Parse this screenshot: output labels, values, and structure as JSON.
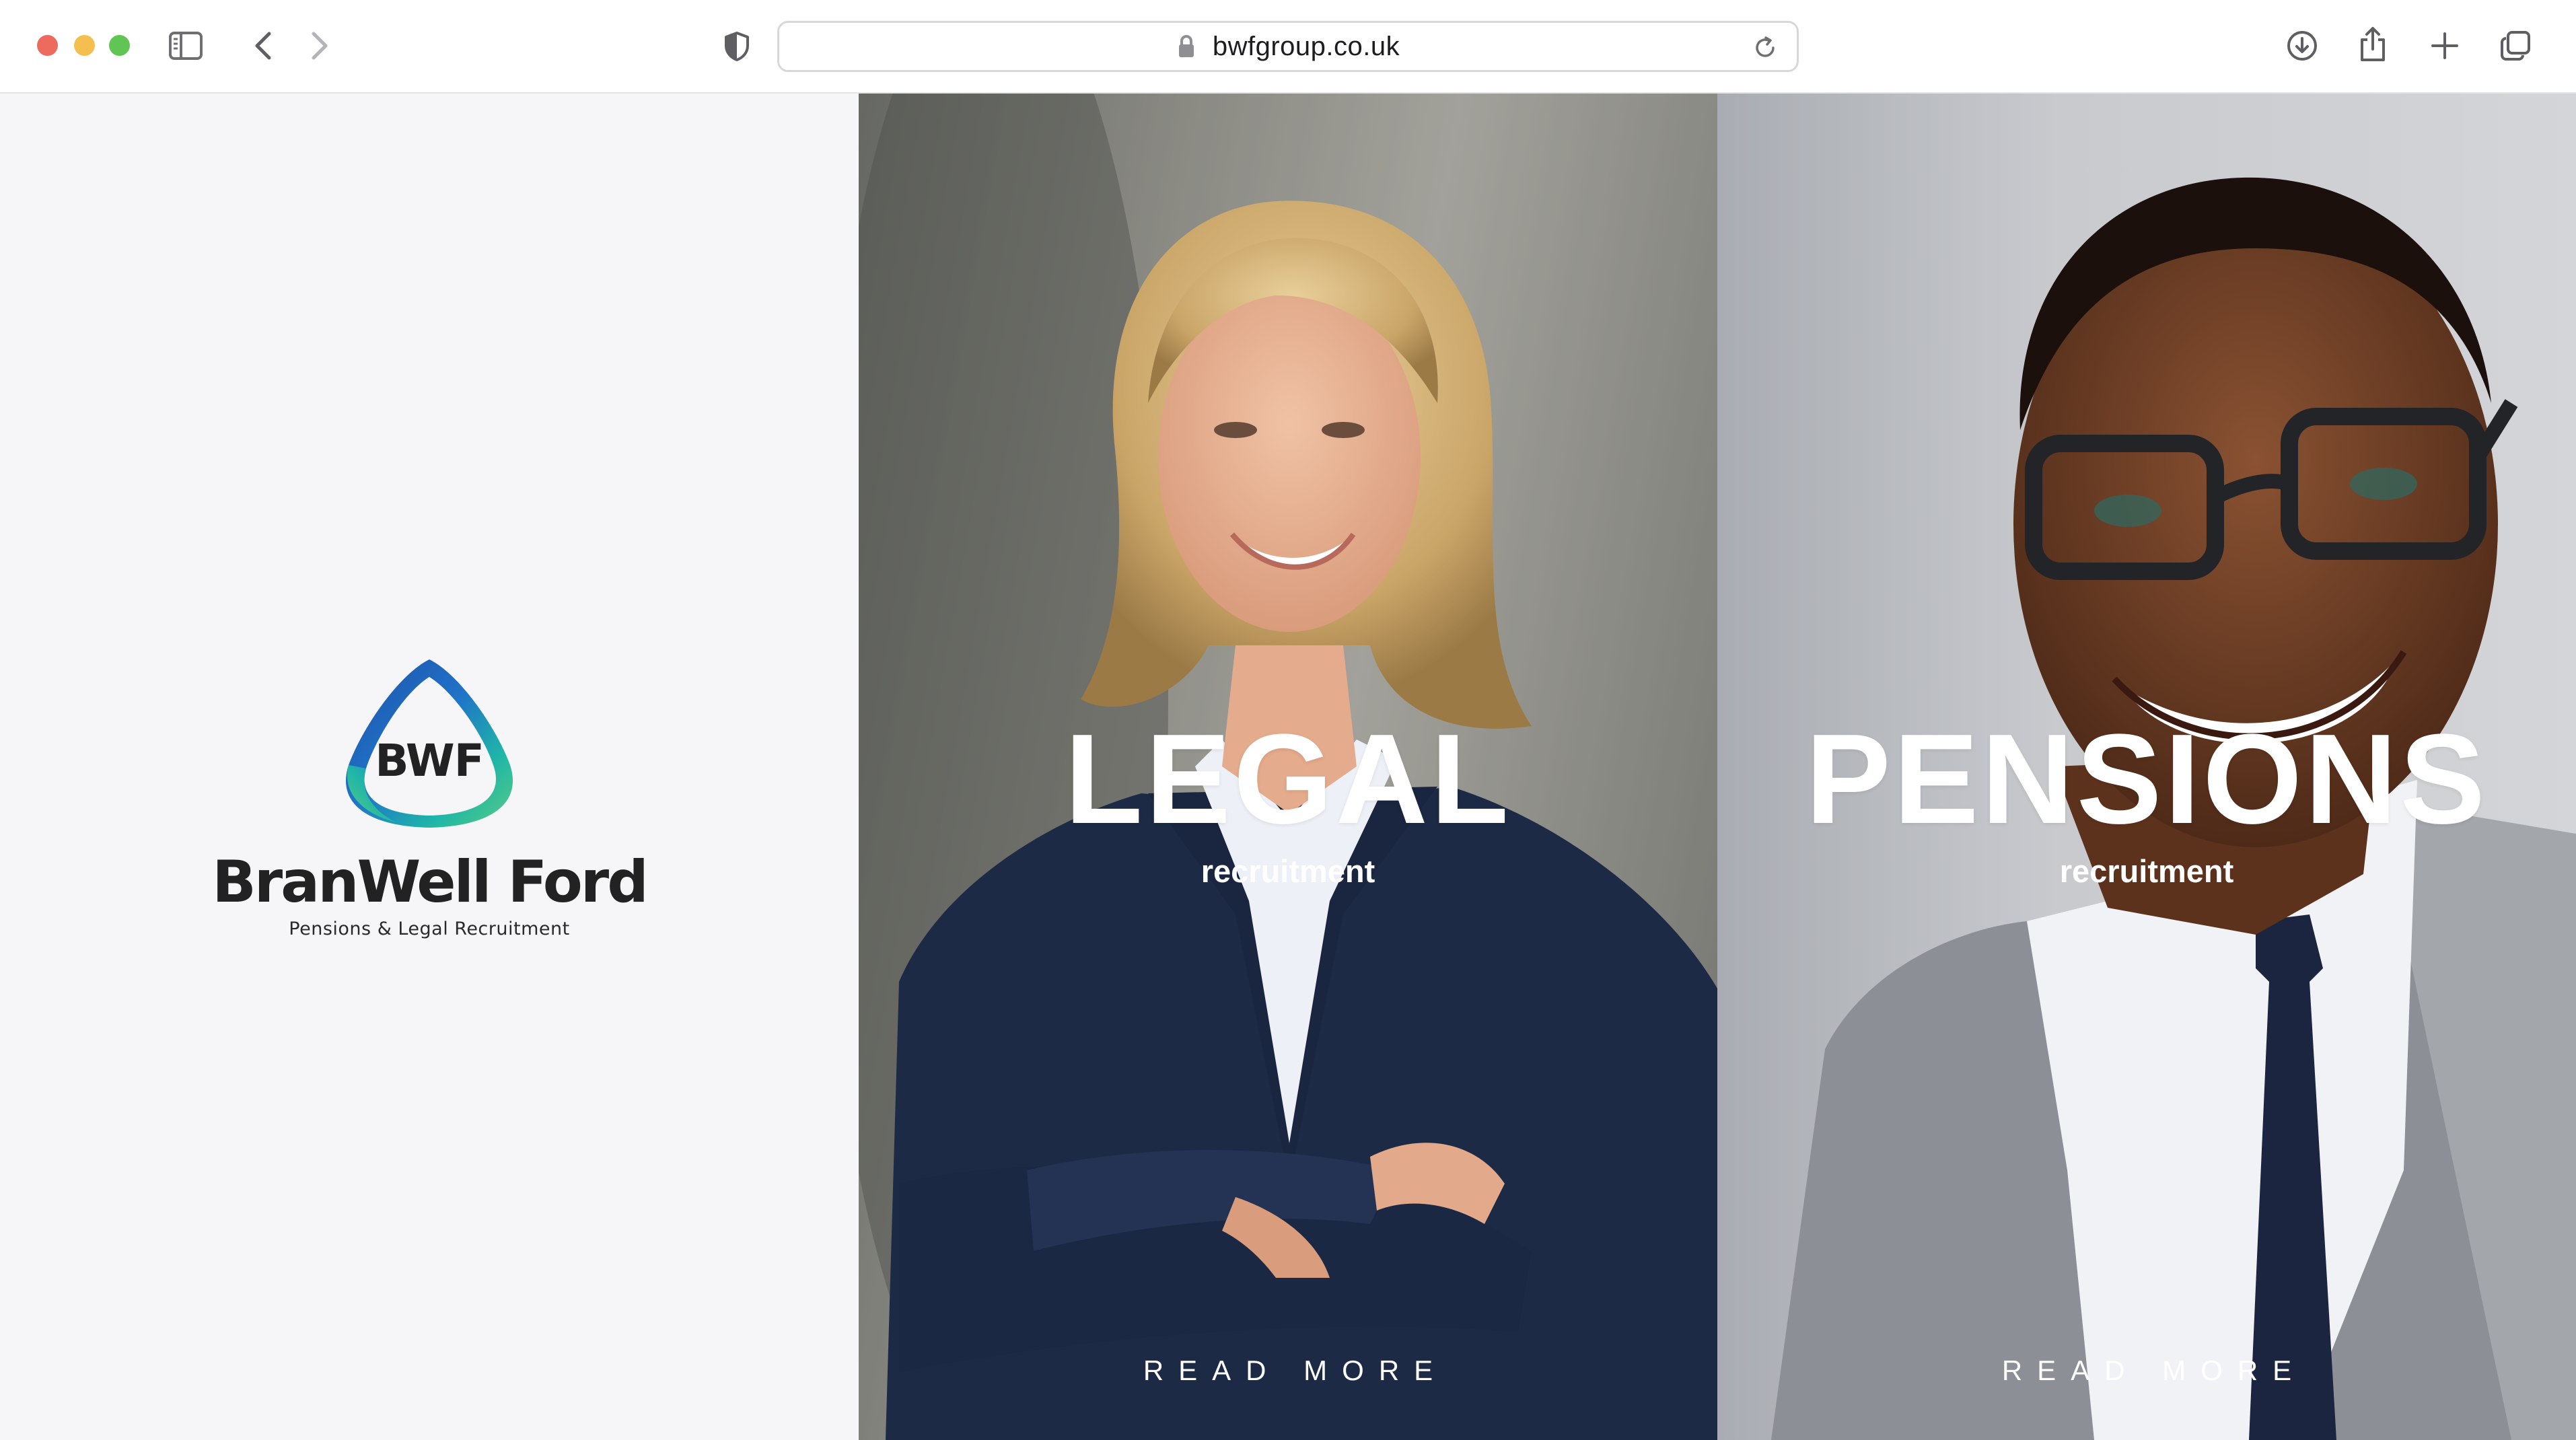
{
  "browser": {
    "url": "bwfgroup.co.uk",
    "icons": {
      "sidebar": "sidebar-icon",
      "back": "chevron-left-icon",
      "forward": "chevron-right-icon",
      "privacy": "shield-icon",
      "lock": "lock-icon",
      "reload": "reload-icon",
      "download": "download-icon",
      "share": "share-icon",
      "new_tab": "plus-icon",
      "tabs": "tabs-overview-icon"
    }
  },
  "brand": {
    "logo_text": "BWF",
    "name": "BranWell Ford",
    "tagline": "Pensions & Legal Recruitment",
    "colors": {
      "logo_blue": "#1f64b3",
      "logo_teal": "#1fb6a8",
      "logo_green": "#58c98c",
      "text": "#222222"
    }
  },
  "cards": [
    {
      "title": "LEGAL",
      "subtitle": "recruitment",
      "cta": "READ MORE"
    },
    {
      "title": "PENSIONS",
      "subtitle": "recruitment",
      "cta": "READ MORE"
    }
  ]
}
